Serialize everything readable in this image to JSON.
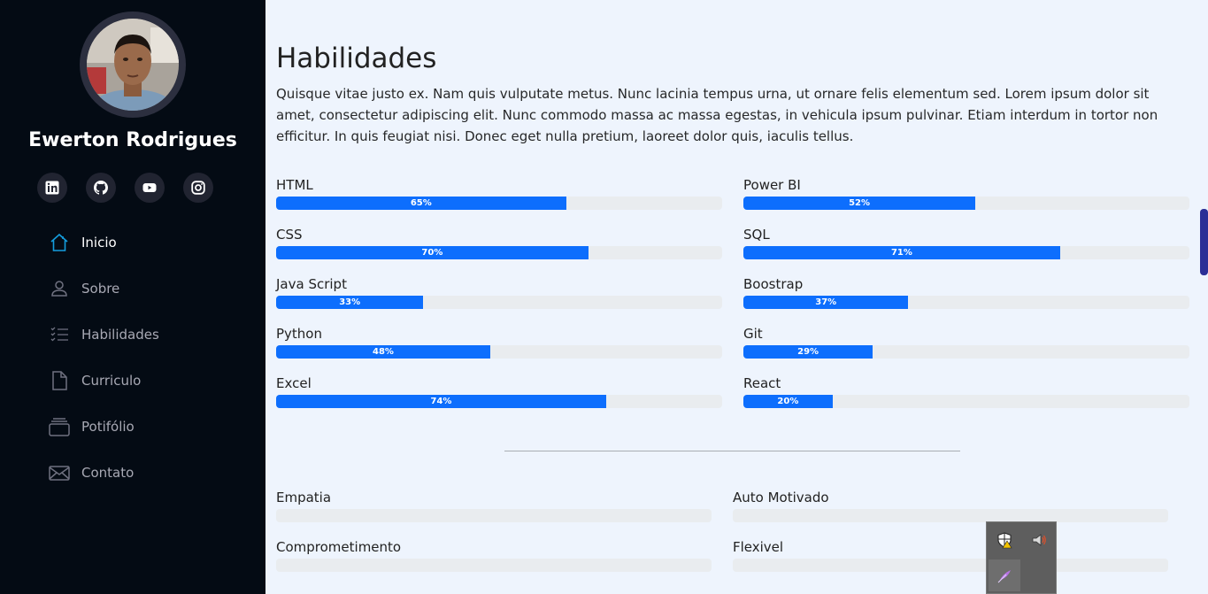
{
  "profile": {
    "name": "Ewerton Rodrigues"
  },
  "socials": [
    {
      "icon": "linkedin-icon"
    },
    {
      "icon": "github-icon"
    },
    {
      "icon": "youtube-icon"
    },
    {
      "icon": "instagram-icon"
    }
  ],
  "nav": [
    {
      "label": "Inicio",
      "icon": "home-icon",
      "active": true
    },
    {
      "label": "Sobre",
      "icon": "person-icon"
    },
    {
      "label": "Habilidades",
      "icon": "list-icon"
    },
    {
      "label": "Curriculo",
      "icon": "file-icon"
    },
    {
      "label": "Potifólio",
      "icon": "collection-icon"
    },
    {
      "label": "Contato",
      "icon": "envelope-icon"
    }
  ],
  "section": {
    "title": "Habilidades",
    "description": "Quisque vitae justo ex. Nam quis vulputate metus. Nunc lacinia tempus urna, ut ornare felis elementum sed. Lorem ipsum dolor sit amet, consectetur adipiscing elit. Nunc commodo massa ac massa egestas, in vehicula ipsum pulvinar. Etiam interdum in tortor non efficitur. In quis feugiat nisi. Donec eget nulla pretium, laoreet dolor quis, iaculis tellus."
  },
  "skills_left": [
    {
      "name": "HTML",
      "value": 65,
      "label": "65%"
    },
    {
      "name": "CSS",
      "value": 70,
      "label": "70%"
    },
    {
      "name": "Java Script",
      "value": 33,
      "label": "33%"
    },
    {
      "name": "Python",
      "value": 48,
      "label": "48%"
    },
    {
      "name": "Excel",
      "value": 74,
      "label": "74%"
    }
  ],
  "skills_right": [
    {
      "name": "Power BI",
      "value": 52,
      "label": "52%"
    },
    {
      "name": "SQL",
      "value": 71,
      "label": "71%"
    },
    {
      "name": "Boostrap",
      "value": 37,
      "label": "37%"
    },
    {
      "name": "Git",
      "value": 29,
      "label": "29%"
    },
    {
      "name": "React",
      "value": 20,
      "label": "20%"
    }
  ],
  "soft_skills_left": [
    "Empatia",
    "Comprometimento"
  ],
  "soft_skills_right": [
    "Auto Motivado",
    "Flexivel"
  ],
  "colors": {
    "sidebar": "#040b14",
    "accent": "#0d6efd",
    "background": "#eef4fd"
  },
  "tray": {
    "icons": [
      "shield-warning-icon",
      "speaker-icon",
      "feather-icon"
    ]
  }
}
